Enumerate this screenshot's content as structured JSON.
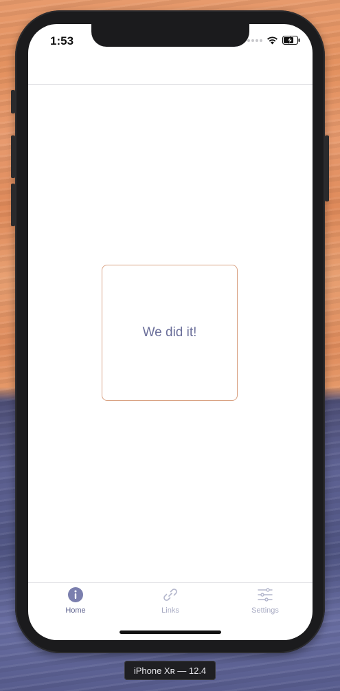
{
  "status_bar": {
    "time": "1:53"
  },
  "main": {
    "card_text": "We did it!"
  },
  "tab_bar": {
    "tabs": [
      {
        "label": "Home",
        "icon": "info-icon",
        "active": true
      },
      {
        "label": "Links",
        "icon": "link-icon",
        "active": false
      },
      {
        "label": "Settings",
        "icon": "sliders-icon",
        "active": false
      }
    ]
  },
  "device": {
    "label": "iPhone Xʀ — 12.4"
  },
  "colors": {
    "active_tab": "#7b7fae",
    "inactive_tab": "#b3b6cc",
    "card_border": "#d9a283",
    "card_text": "#6b6f9a"
  }
}
